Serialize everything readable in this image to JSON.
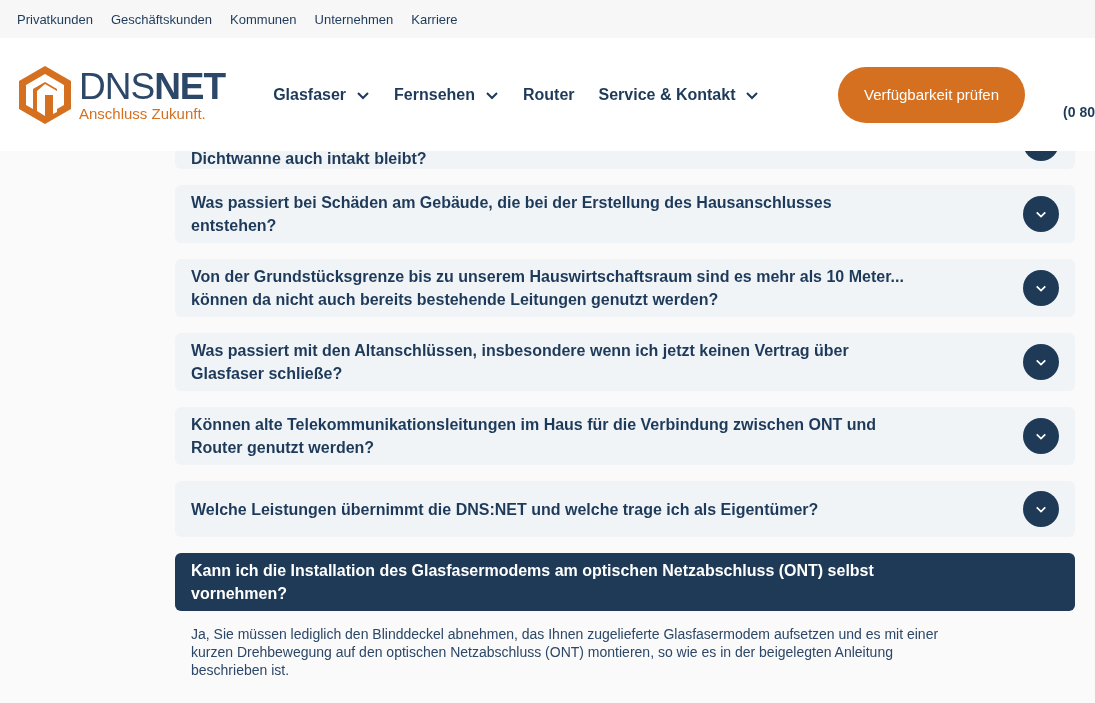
{
  "top_links": [
    "Privatkunden",
    "Geschäftskunden",
    "Kommunen",
    "Unternehmen",
    "Karriere"
  ],
  "logo": {
    "brand_light": "DNS",
    "brand_bold": "NET",
    "tagline": "Anschluss Zukunft."
  },
  "nav": [
    {
      "label": "Glasfaser",
      "dropdown": true
    },
    {
      "label": "Fernsehen",
      "dropdown": true
    },
    {
      "label": "Router",
      "dropdown": false
    },
    {
      "label": "Service & Kontakt",
      "dropdown": true
    }
  ],
  "cta_button": "Verfügbarkeit prüfen",
  "phone": "(0 80",
  "faq": [
    {
      "question": "Dichtwanne auch intakt bleibt?",
      "expanded": false,
      "partial": true
    },
    {
      "question": "Was passiert bei Schäden am Gebäude, die bei der Erstellung des Hausanschlusses entstehen?",
      "expanded": false
    },
    {
      "question": "Von der Grundstücksgrenze bis zu unserem Hauswirtschaftsraum sind es mehr als 10 Meter... können da nicht auch bereits bestehende Leitungen genutzt werden?",
      "expanded": false
    },
    {
      "question": "Was passiert mit den Altanschlüssen, insbesondere wenn ich jetzt keinen Vertrag über Glasfaser schließe?",
      "expanded": false
    },
    {
      "question": "Können alte Telekommunikationsleitungen im Haus für die Verbindung zwischen ONT und Router genutzt werden?",
      "expanded": false
    },
    {
      "question": "Welche Leistungen übernimmt die DNS:NET und welche trage ich als Eigentümer?",
      "expanded": false
    },
    {
      "question": "Kann ich die Installation des Glasfasermodems am optischen Netzabschluss (ONT) selbst vornehmen?",
      "expanded": true,
      "answer": "Ja, Sie müssen lediglich den Blinddeckel abnehmen, das Ihnen zugelieferte Glasfasermodem aufsetzen und es mit einer kurzen Drehbewegung auf den optischen Netzabschluss (ONT) montieren, so wie es in der beigelegten Anleitung beschrieben ist."
    }
  ]
}
